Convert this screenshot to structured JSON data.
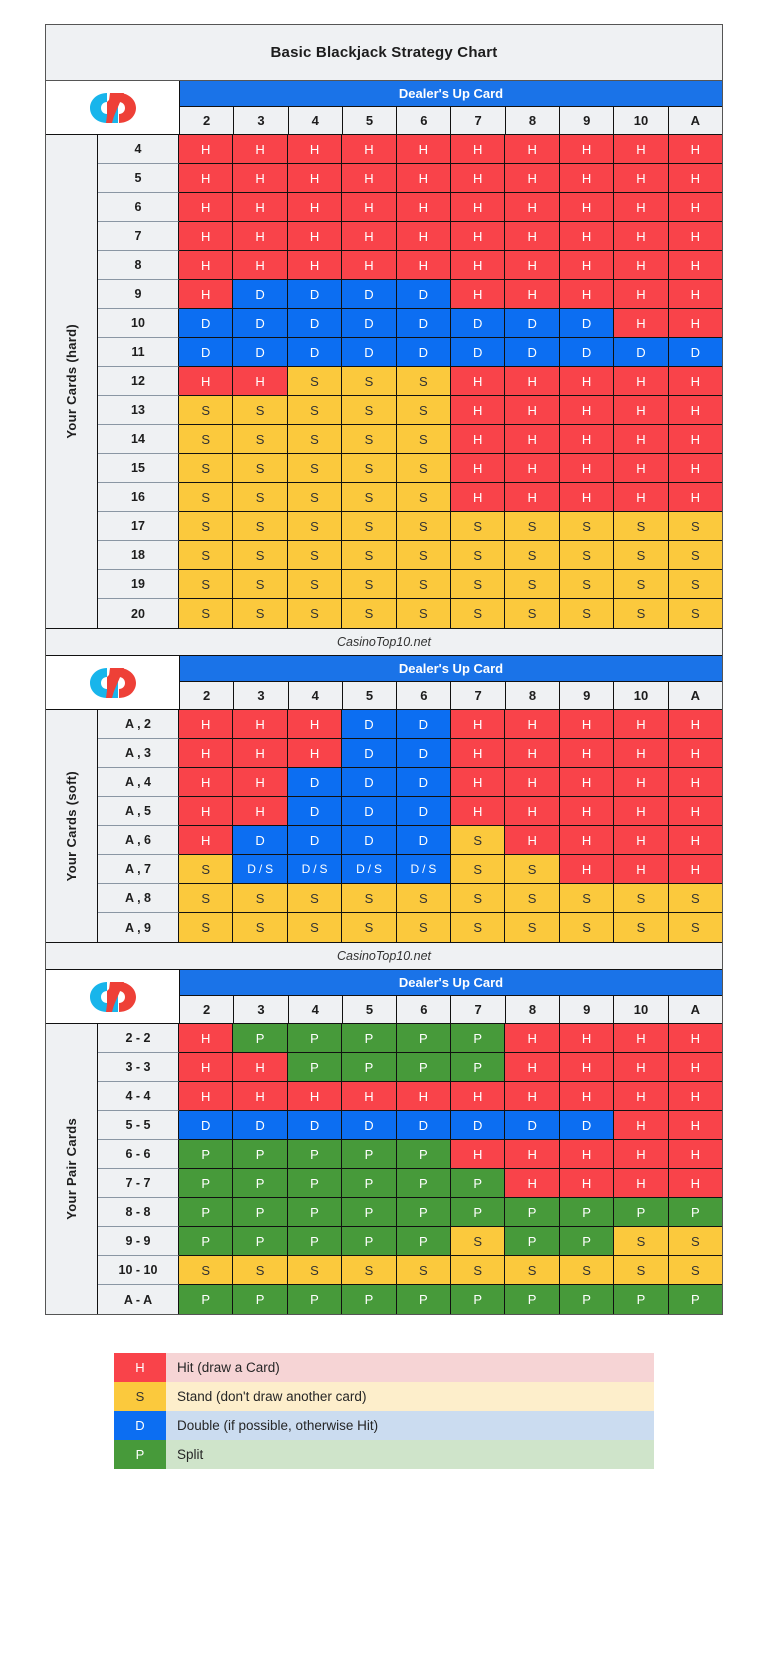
{
  "title": "Basic Blackjack Strategy Chart",
  "attribution": "CasinoTop10.net",
  "dealer_header": "Dealer's Up Card",
  "logo_name": "casinotop10-logo",
  "colors": {
    "hit": "#f9434a",
    "stand": "#fbc93d",
    "double": "#0c6ef2",
    "split": "#479a3a",
    "header_blue": "#1a73e8",
    "header_grey": "#eff1f3"
  },
  "legend": [
    {
      "key": "H",
      "label": "Hit (draw a Card)",
      "color": "#f9434a",
      "row_tint": "#f6d4d5"
    },
    {
      "key": "S",
      "label": "Stand (don't draw another card)",
      "color": "#fbc93d",
      "row_tint": "#fdeecb"
    },
    {
      "key": "D",
      "label": "Double (if possible, otherwise Hit)",
      "color": "#0c6ef2",
      "row_tint": "#cbdcf0"
    },
    {
      "key": "P",
      "label": "Split",
      "color": "#479a3a",
      "row_tint": "#cfe4ca"
    }
  ],
  "chart_data": {
    "type": "heatmap",
    "title": "Basic Blackjack Strategy Chart",
    "xlabel": "Dealer's Up Card",
    "legend_position": "bottom",
    "value_labels": {
      "H": "Hit",
      "S": "Stand",
      "D": "Double",
      "D / S": "Double or Stand",
      "P": "Split"
    },
    "categories": [
      "2",
      "3",
      "4",
      "5",
      "6",
      "7",
      "8",
      "9",
      "10",
      "A"
    ],
    "sections": [
      {
        "id": "hard",
        "ylabel": "Your Cards (hard)",
        "rows": [
          "4",
          "5",
          "6",
          "7",
          "8",
          "9",
          "10",
          "11",
          "12",
          "13",
          "14",
          "15",
          "16",
          "17",
          "18",
          "19",
          "20"
        ],
        "values": [
          [
            "H",
            "H",
            "H",
            "H",
            "H",
            "H",
            "H",
            "H",
            "H",
            "H"
          ],
          [
            "H",
            "H",
            "H",
            "H",
            "H",
            "H",
            "H",
            "H",
            "H",
            "H"
          ],
          [
            "H",
            "H",
            "H",
            "H",
            "H",
            "H",
            "H",
            "H",
            "H",
            "H"
          ],
          [
            "H",
            "H",
            "H",
            "H",
            "H",
            "H",
            "H",
            "H",
            "H",
            "H"
          ],
          [
            "H",
            "H",
            "H",
            "H",
            "H",
            "H",
            "H",
            "H",
            "H",
            "H"
          ],
          [
            "H",
            "D",
            "D",
            "D",
            "D",
            "H",
            "H",
            "H",
            "H",
            "H"
          ],
          [
            "D",
            "D",
            "D",
            "D",
            "D",
            "D",
            "D",
            "D",
            "H",
            "H"
          ],
          [
            "D",
            "D",
            "D",
            "D",
            "D",
            "D",
            "D",
            "D",
            "D",
            "D"
          ],
          [
            "H",
            "H",
            "S",
            "S",
            "S",
            "H",
            "H",
            "H",
            "H",
            "H"
          ],
          [
            "S",
            "S",
            "S",
            "S",
            "S",
            "H",
            "H",
            "H",
            "H",
            "H"
          ],
          [
            "S",
            "S",
            "S",
            "S",
            "S",
            "H",
            "H",
            "H",
            "H",
            "H"
          ],
          [
            "S",
            "S",
            "S",
            "S",
            "S",
            "H",
            "H",
            "H",
            "H",
            "H"
          ],
          [
            "S",
            "S",
            "S",
            "S",
            "S",
            "H",
            "H",
            "H",
            "H",
            "H"
          ],
          [
            "S",
            "S",
            "S",
            "S",
            "S",
            "S",
            "S",
            "S",
            "S",
            "S"
          ],
          [
            "S",
            "S",
            "S",
            "S",
            "S",
            "S",
            "S",
            "S",
            "S",
            "S"
          ],
          [
            "S",
            "S",
            "S",
            "S",
            "S",
            "S",
            "S",
            "S",
            "S",
            "S"
          ],
          [
            "S",
            "S",
            "S",
            "S",
            "S",
            "S",
            "S",
            "S",
            "S",
            "S"
          ]
        ]
      },
      {
        "id": "soft",
        "ylabel": "Your Cards (soft)",
        "rows": [
          "A , 2",
          "A , 3",
          "A , 4",
          "A , 5",
          "A , 6",
          "A , 7",
          "A , 8",
          "A , 9"
        ],
        "values": [
          [
            "H",
            "H",
            "H",
            "D",
            "D",
            "H",
            "H",
            "H",
            "H",
            "H"
          ],
          [
            "H",
            "H",
            "H",
            "D",
            "D",
            "H",
            "H",
            "H",
            "H",
            "H"
          ],
          [
            "H",
            "H",
            "D",
            "D",
            "D",
            "H",
            "H",
            "H",
            "H",
            "H"
          ],
          [
            "H",
            "H",
            "D",
            "D",
            "D",
            "H",
            "H",
            "H",
            "H",
            "H"
          ],
          [
            "H",
            "D",
            "D",
            "D",
            "D",
            "S",
            "H",
            "H",
            "H",
            "H"
          ],
          [
            "S",
            "D / S",
            "D / S",
            "D / S",
            "D / S",
            "S",
            "S",
            "H",
            "H",
            "H"
          ],
          [
            "S",
            "S",
            "S",
            "S",
            "S",
            "S",
            "S",
            "S",
            "S",
            "S"
          ],
          [
            "S",
            "S",
            "S",
            "S",
            "S",
            "S",
            "S",
            "S",
            "S",
            "S"
          ]
        ]
      },
      {
        "id": "pairs",
        "ylabel": "Your Pair Cards",
        "rows": [
          "2 - 2",
          "3 - 3",
          "4 - 4",
          "5 - 5",
          "6 - 6",
          "7 - 7",
          "8 - 8",
          "9 - 9",
          "10 - 10",
          "A - A"
        ],
        "values": [
          [
            "H",
            "P",
            "P",
            "P",
            "P",
            "P",
            "H",
            "H",
            "H",
            "H"
          ],
          [
            "H",
            "H",
            "P",
            "P",
            "P",
            "P",
            "H",
            "H",
            "H",
            "H"
          ],
          [
            "H",
            "H",
            "H",
            "H",
            "H",
            "H",
            "H",
            "H",
            "H",
            "H"
          ],
          [
            "D",
            "D",
            "D",
            "D",
            "D",
            "D",
            "D",
            "D",
            "H",
            "H"
          ],
          [
            "P",
            "P",
            "P",
            "P",
            "P",
            "H",
            "H",
            "H",
            "H",
            "H"
          ],
          [
            "P",
            "P",
            "P",
            "P",
            "P",
            "P",
            "H",
            "H",
            "H",
            "H"
          ],
          [
            "P",
            "P",
            "P",
            "P",
            "P",
            "P",
            "P",
            "P",
            "P",
            "P"
          ],
          [
            "P",
            "P",
            "P",
            "P",
            "P",
            "S",
            "P",
            "P",
            "S",
            "S"
          ],
          [
            "S",
            "S",
            "S",
            "S",
            "S",
            "S",
            "S",
            "S",
            "S",
            "S"
          ],
          [
            "P",
            "P",
            "P",
            "P",
            "P",
            "P",
            "P",
            "P",
            "P",
            "P"
          ]
        ]
      }
    ]
  }
}
